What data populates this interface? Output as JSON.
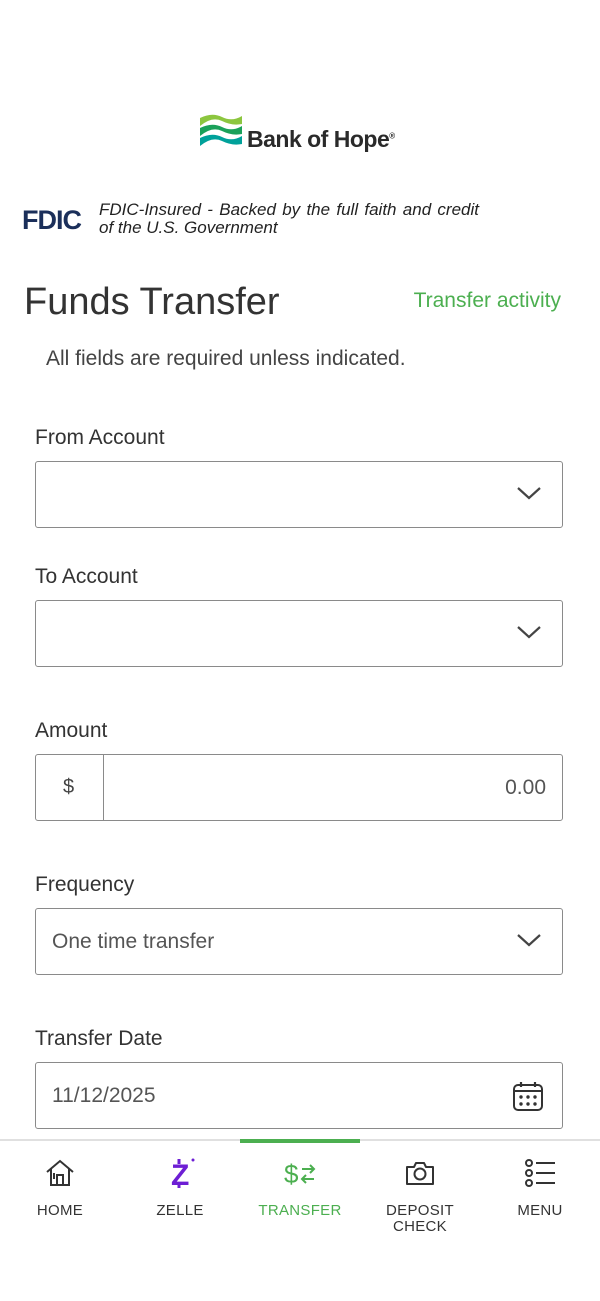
{
  "brand": {
    "name": "Bank of Hope",
    "mark": "®",
    "logo_colors": [
      "#1aa15a",
      "#8cc63f",
      "#00a19a"
    ]
  },
  "fdic": {
    "logo": "FDIC",
    "text": "FDIC-Insured - Backed by the full faith and credit of the U.S. Government"
  },
  "page": {
    "title": "Funds Transfer",
    "activity_link": "Transfer activity",
    "required_note": "All fields are required unless indicated."
  },
  "form": {
    "from_account": {
      "label": "From Account",
      "value": ""
    },
    "to_account": {
      "label": "To Account",
      "value": ""
    },
    "amount": {
      "label": "Amount",
      "currency": "$",
      "value": "0.00"
    },
    "frequency": {
      "label": "Frequency",
      "value": "One time transfer"
    },
    "transfer_date": {
      "label": "Transfer Date",
      "value": "11/12/2025"
    }
  },
  "nav": {
    "items": [
      {
        "label": "HOME",
        "icon": "home-icon"
      },
      {
        "label": "ZELLE",
        "icon": "zelle-icon"
      },
      {
        "label": "TRANSFER",
        "icon": "transfer-icon",
        "active": true
      },
      {
        "label": "DEPOSIT\nCHECK",
        "icon": "camera-icon"
      },
      {
        "label": "MENU",
        "icon": "menu-icon"
      }
    ]
  },
  "colors": {
    "accent": "#4caf50",
    "zelle": "#6d1ed4",
    "fdic": "#1b2f5a"
  }
}
